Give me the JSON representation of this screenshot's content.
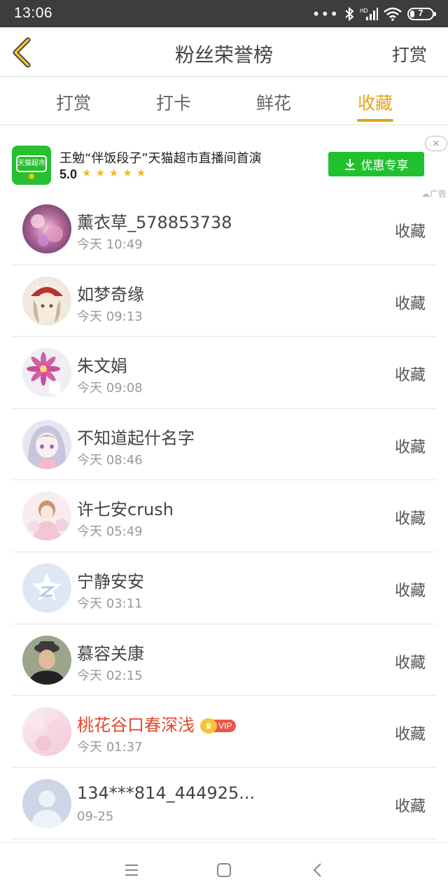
{
  "status_bar": {
    "time": "13:06",
    "network": "HD",
    "battery": "7"
  },
  "header": {
    "title": "粉丝荣誉榜",
    "right_action": "打赏"
  },
  "tabs": [
    {
      "label": "打赏",
      "active": false
    },
    {
      "label": "打卡",
      "active": false
    },
    {
      "label": "鲜花",
      "active": false
    },
    {
      "label": "收藏",
      "active": true
    }
  ],
  "ad": {
    "logo_text": "天猫超市",
    "title": "王勉“伴饭段子”天猫超市直播间首演",
    "rating": "5.0",
    "stars": "★★★★★",
    "button_label": "优惠专享",
    "close": "×",
    "tag": "广告"
  },
  "list": [
    {
      "name": "薰衣草_578853738",
      "time": "今天 10:49",
      "action": "收藏",
      "vip": false
    },
    {
      "name": "如梦奇缘",
      "time": "今天 09:13",
      "action": "收藏",
      "vip": false
    },
    {
      "name": "朱文娟",
      "time": "今天 09:08",
      "action": "收藏",
      "vip": false
    },
    {
      "name": "不知道起什名字",
      "time": "今天 08:46",
      "action": "收藏",
      "vip": false
    },
    {
      "name": "许七安crush",
      "time": "今天 05:49",
      "action": "收藏",
      "vip": false
    },
    {
      "name": "宁静安安",
      "time": "今天 03:11",
      "action": "收藏",
      "vip": false
    },
    {
      "name": "慕容关康",
      "time": "今天 02:15",
      "action": "收藏",
      "vip": false
    },
    {
      "name": "桃花谷口春深浅",
      "time": "今天 01:37",
      "action": "收藏",
      "vip": true,
      "vip_label": "VIP"
    },
    {
      "name": "134***814_444925...",
      "time": "09-25",
      "action": "收藏",
      "vip": false
    }
  ],
  "colors": {
    "accent": "#e8a21a",
    "ad_green": "#21c02f",
    "vip_name": "#e0482c",
    "status_bar": "#3d3d3d"
  }
}
